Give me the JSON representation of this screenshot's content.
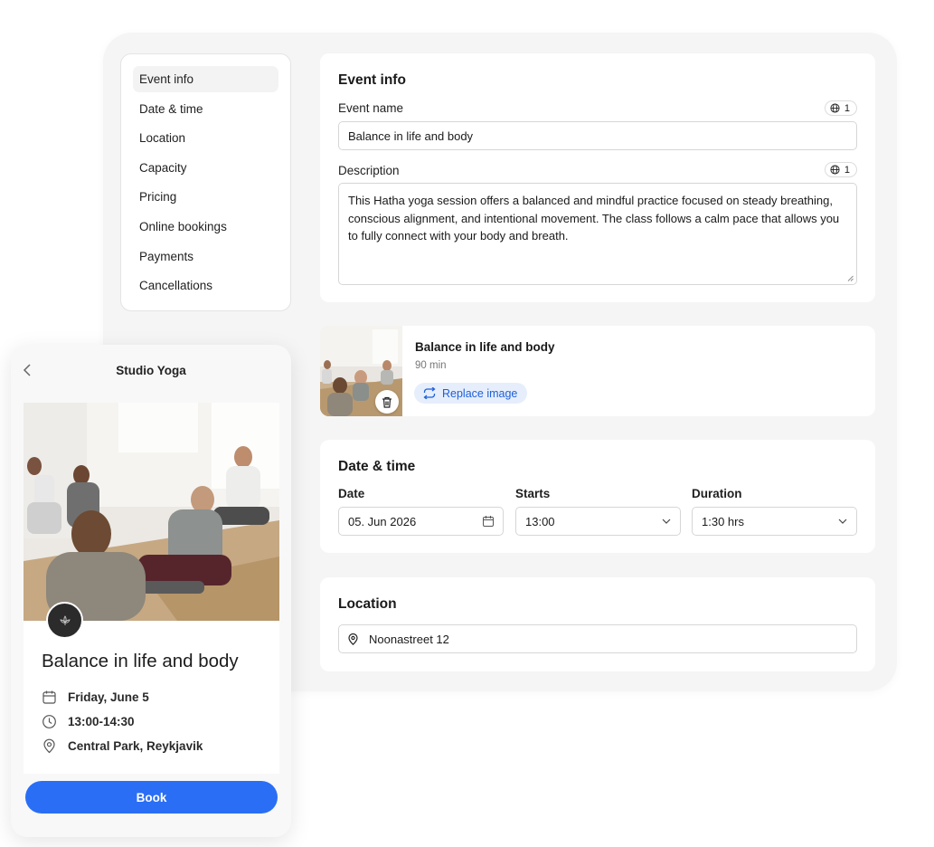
{
  "nav": {
    "items": [
      {
        "label": "Event info",
        "active": true
      },
      {
        "label": "Date & time"
      },
      {
        "label": "Location"
      },
      {
        "label": "Capacity"
      },
      {
        "label": "Pricing"
      },
      {
        "label": "Online bookings"
      },
      {
        "label": "Payments"
      },
      {
        "label": "Cancellations"
      }
    ]
  },
  "event_info": {
    "heading": "Event info",
    "name_label": "Event name",
    "name_lang_count": "1",
    "name_value": "Balance in life and body",
    "description_label": "Description",
    "description_lang_count": "1",
    "description_value": "This Hatha yoga session offers a balanced and mindful practice focused on steady breathing, conscious alignment, and intentional movement. The class follows a calm pace that allows you to fully connect with your body and breath."
  },
  "image_card": {
    "title": "Balance in life and body",
    "duration": "90 min",
    "replace_label": "Replace image",
    "icons": {
      "delete": "trash-icon",
      "replace": "refresh-icon"
    }
  },
  "datetime": {
    "heading": "Date & time",
    "date_label": "Date",
    "date_value": "05. Jun 2026",
    "starts_label": "Starts",
    "starts_value": "13:00",
    "duration_label": "Duration",
    "duration_value": "1:30 hrs"
  },
  "location": {
    "heading": "Location",
    "value": "Noonastreet 12"
  },
  "phone": {
    "header_title": "Studio Yoga",
    "event_title": "Balance in life and body",
    "date": "Friday, June 5",
    "time": "13:00-14:30",
    "place": "Central Park, Reykjavik",
    "book_label": "Book"
  },
  "colors": {
    "accent": "#2a6ef5",
    "replace_bg": "#e6eefc",
    "replace_text": "#1e5fd9",
    "panel_bg": "#f5f5f5"
  }
}
